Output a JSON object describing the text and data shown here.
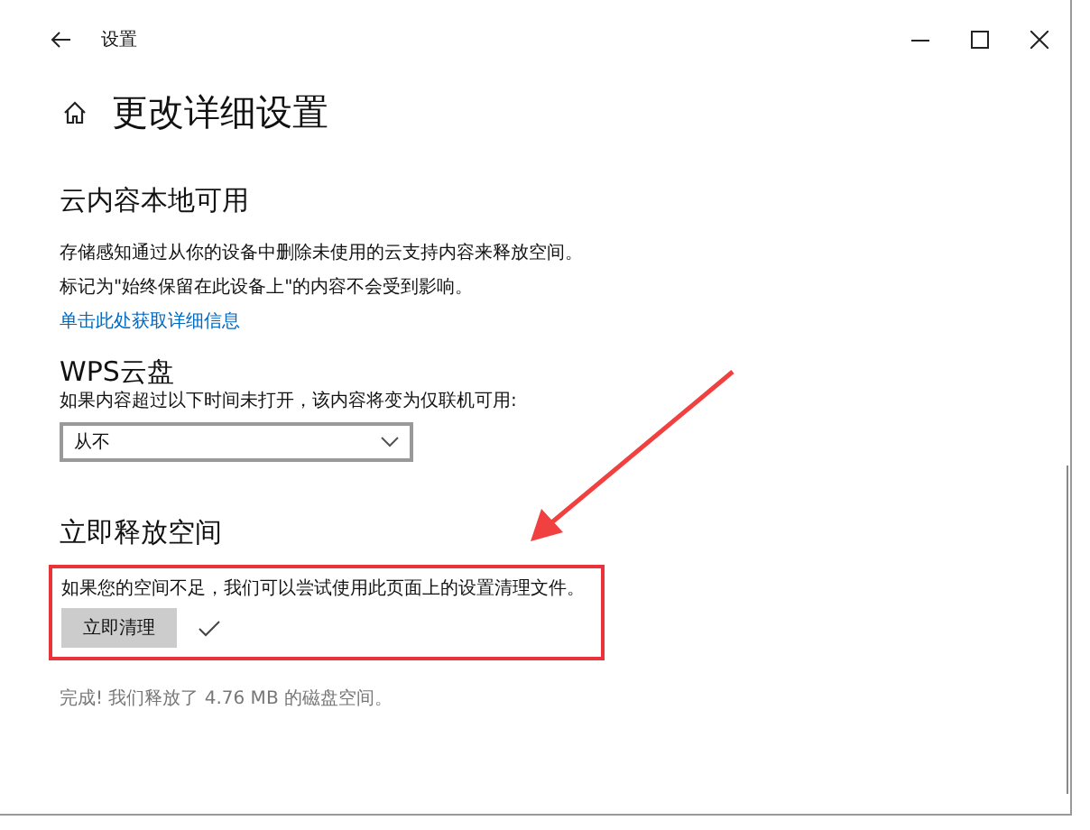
{
  "window": {
    "title": "设置"
  },
  "page_title": "更改详细设置",
  "cloud_section": {
    "heading": "云内容本地可用",
    "lines": [
      "存储感知通过从你的设备中删除未使用的云支持内容来释放空间。",
      "标记为\"始终保留在此设备上\"的内容不会受到影响。"
    ],
    "link": "单击此处获取详细信息"
  },
  "wps_section": {
    "heading": "WPS云盘",
    "description": "如果内容超过以下时间未打开，该内容将变为仅联机可用:",
    "dropdown": {
      "value": "从不"
    }
  },
  "free_space_section": {
    "heading": "立即释放空间",
    "highlighted": true,
    "description": "如果您的空间不足，我们可以尝试使用此页面上的设置清理文件。",
    "button": "立即清理",
    "done": true,
    "status": "完成! 我们释放了 4.76 MB 的磁盘空间。"
  }
}
